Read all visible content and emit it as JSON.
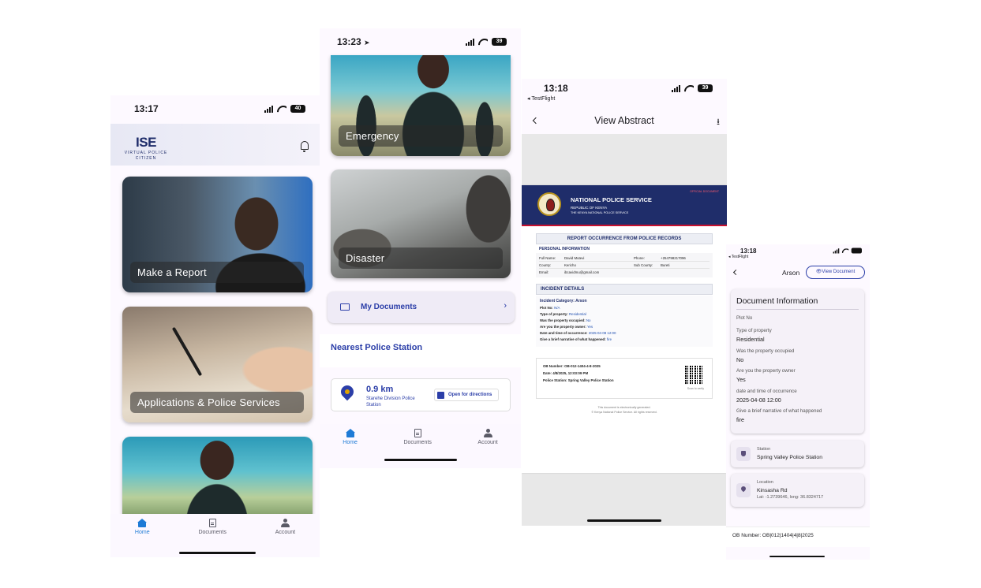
{
  "screen1": {
    "time": "13:17",
    "battery": "40",
    "logo_main": "ISE",
    "logo_sub": "VIRTUAL POLICE\nCITIZEN",
    "cards": [
      "Make a Report",
      "Applications &  Police Services"
    ],
    "nav": [
      "Home",
      "Documents",
      "Account"
    ]
  },
  "screen2": {
    "time": "13:23",
    "battery": "39",
    "cards": [
      "Emergency",
      "Disaster"
    ],
    "my_documents": "My Documents",
    "nearest_title": "Nearest Police Station",
    "distance": "0.9 km",
    "station_name": "Starehe Division Police Station",
    "directions": "Open for directions",
    "nav": [
      "Home",
      "Documents",
      "Account"
    ]
  },
  "screen3": {
    "time": "13:18",
    "back_app": "◂ TestFlight",
    "battery": "39",
    "title": "View Abstract",
    "doc": {
      "official": "OFFICIAL DOCUMENT",
      "org": "NATIONAL POLICE SERVICE",
      "republic": "REPUBLIC OF KENYA",
      "service": "THE KENYA NATIONAL POLICE SERVICE",
      "report_title": "REPORT OCCURRENCE FROM POLICE RECORDS",
      "personal_title": "PERSONAL INFORMATION",
      "personal": [
        {
          "k": "Full Name:",
          "v": "David Mutevi",
          "k2": "Phone:",
          "v2": "+254798217096"
        },
        {
          "k": "County:",
          "v": "Kericho",
          "k2": "Sub County:",
          "v2": "Bureti"
        },
        {
          "k": "Email:",
          "v": "ibcavidmu@gmail.com",
          "k2": "",
          "v2": ""
        }
      ],
      "incident_title": "INCIDENT DETAILS",
      "incident_category": "Incident Category: Arson",
      "incident_rows": [
        {
          "k": "Plot No:",
          "v": "N/A"
        },
        {
          "k": "Type of property:",
          "v": "Residential"
        },
        {
          "k": "Was the property occupied:",
          "v": "No"
        },
        {
          "k": "Are you the property owner:",
          "v": "Yes"
        },
        {
          "k": "Date and time of occurrence:",
          "v": "2025-04-08 12:00"
        },
        {
          "k": "Give a brief narrative of what happened:",
          "v": "fire"
        }
      ],
      "ob_number": "OB Number: OB-012-1404-4-8-2025",
      "ob_date": "Date: 4/8/2025, 12:03:09 PM",
      "ob_station": "Police Station: Spring Valley Police Station",
      "scan": "Scan to verify",
      "footer1": "This document is electronically generated.",
      "footer2": "© Kenya National Police Service. All rights reserved."
    }
  },
  "screen4": {
    "time": "13:18",
    "back_app": "◂ TestFlight",
    "title": "Arson",
    "view_doc": "View Document",
    "section_title": "Document Information",
    "fields": [
      {
        "label": "Plot No",
        "value": ""
      },
      {
        "label": "Type of property",
        "value": "Residential"
      },
      {
        "label": "Was the property occupied",
        "value": "No"
      },
      {
        "label": "Are you the property owner",
        "value": "Yes"
      },
      {
        "label": "date and time of occurrence",
        "value": "2025-04-08 12:00"
      },
      {
        "label": "Give a brief narrative of what happened",
        "value": "fire"
      }
    ],
    "station_label": "Station",
    "station_value": "Spring Valley Police Station",
    "location_label": "Location",
    "location_value": "Kinsasha Rd",
    "location_coords": "Lat: -1.2739646, long: 36.8324717",
    "ob_number": "OB Number: OB|012|1404|4|8|2025"
  },
  "colors": {
    "accent": "#1e7bd6",
    "navy": "#1f2d6a",
    "link": "#2b3ea8"
  }
}
